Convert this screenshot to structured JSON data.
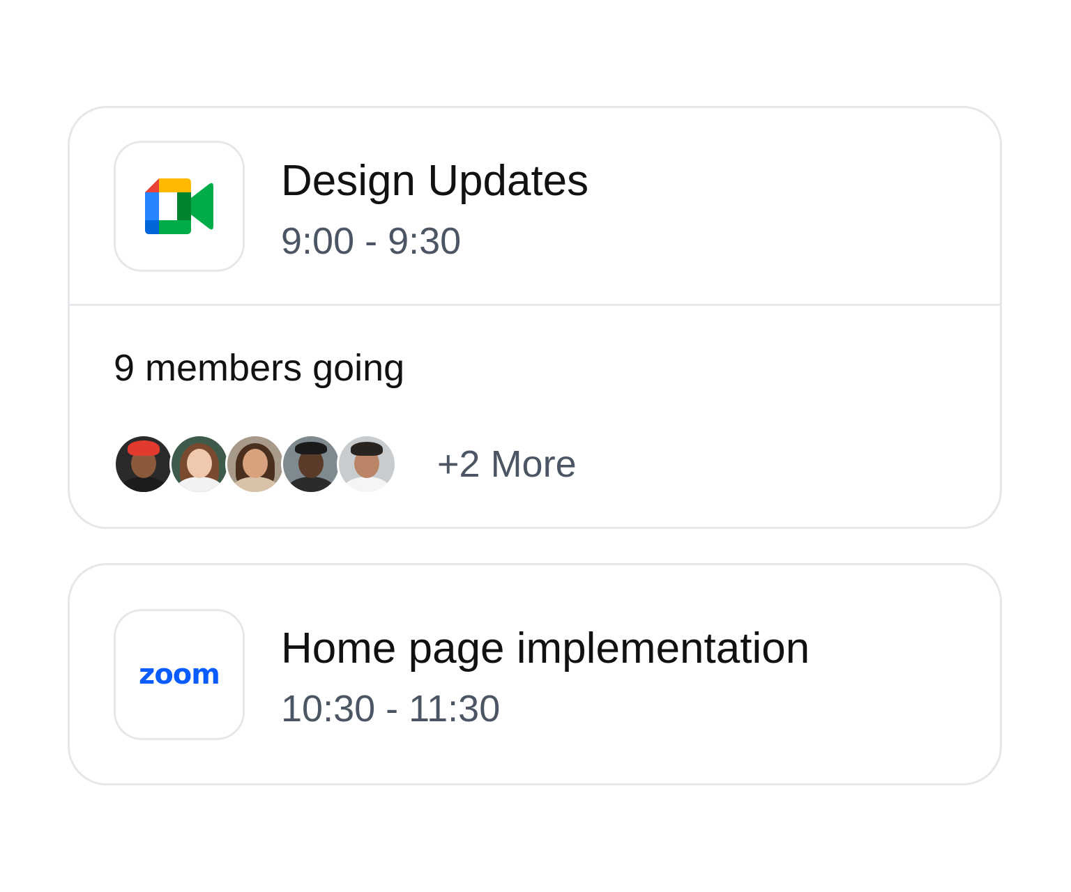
{
  "events": [
    {
      "title": "Design Updates",
      "time": "9:00 - 9:30",
      "app_icon": "google-meet-icon",
      "members_label": "9 members going",
      "more_label": "+2 More",
      "avatars": [
        "member-avatar",
        "member-avatar",
        "member-avatar",
        "member-avatar",
        "member-avatar"
      ]
    },
    {
      "title": "Home page implementation",
      "time": "10:30 - 11:30",
      "app_icon": "zoom-icon",
      "logo_text": "zoom"
    }
  ],
  "colors": {
    "border": "#e5e7eb",
    "title_text": "#111111",
    "secondary_text": "#4b5563",
    "zoom_blue": "#0b5cff",
    "meet_blue": "#2684fc",
    "meet_red": "#ea4335",
    "meet_yellow": "#ffba00",
    "meet_green": "#00ac47",
    "meet_dark_green": "#00832d"
  }
}
